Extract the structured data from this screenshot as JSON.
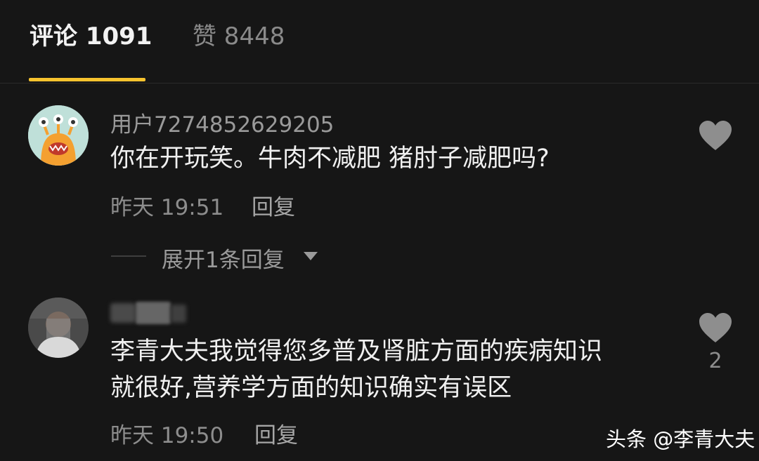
{
  "tabs": {
    "comments_label": "评论 1091",
    "likes_label": "赞 8448"
  },
  "colors": {
    "accent": "#f7c32e",
    "background": "#161616"
  },
  "comments": [
    {
      "username": "用户7274852629205",
      "text": "你在开玩笑。牛肉不减肥 猪肘子减肥吗?",
      "time": "昨天 19:51",
      "reply_label": "回复",
      "like_icon": "heart-icon",
      "like_count": "",
      "expand_label": "展开1条回复"
    },
    {
      "username": "",
      "text_line1": "李青大夫我觉得您多普及肾脏方面的疾病知识",
      "text_line2": "就很好,营养学方面的知识确实有误区",
      "time": "昨天 19:50",
      "reply_label": "回复",
      "like_icon": "heart-icon",
      "like_count": "2"
    }
  ],
  "watermark": "头条 @李青大夫"
}
